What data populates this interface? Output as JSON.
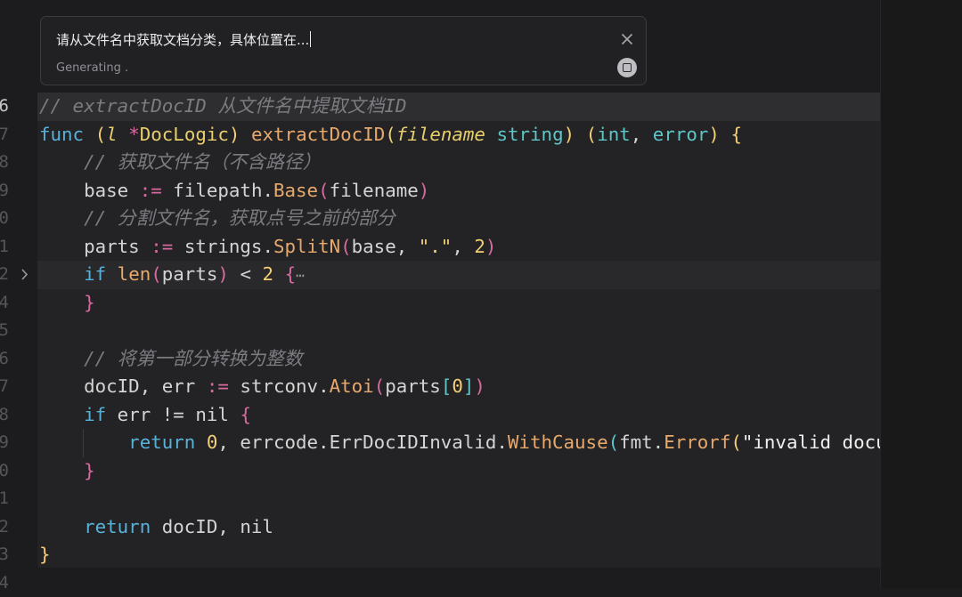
{
  "prompt": {
    "input_text": "请从文件名中获取文档分类，具体位置在...",
    "status_text": "Generating",
    "status_dots": ".",
    "close_icon": "close-icon",
    "stop_icon": "stop-icon"
  },
  "gutter": {
    "line_numbers": [
      "6",
      "7",
      "8",
      "9",
      "0",
      "1",
      "2",
      "4",
      "5",
      "6",
      "7",
      "8",
      "9",
      "0",
      "1",
      "2",
      "3",
      "4"
    ],
    "fold_icon": "chevron-right-icon"
  },
  "code": {
    "l1": {
      "comment": "// extractDocID 从文件名中提取文档ID"
    },
    "l2": {
      "kw_func": "func",
      "paren_open": "(",
      "recv": "l",
      "star": "*",
      "recv_type": "DocLogic",
      "paren_close": ")",
      "fn_name": "extractDocID",
      "p_open": "(",
      "param": "filename",
      "param_type": "string",
      "p_close": ")",
      "r_open": "(",
      "r_int": "int",
      "comma": ", ",
      "r_error": "error",
      "r_close": ")",
      "brace": "{"
    },
    "l3": {
      "comment": "// 获取文件名（不含路径）"
    },
    "l4": {
      "lhs": "base",
      "op": ":=",
      "pkg": "filepath.",
      "fn": "Base",
      "open": "(",
      "arg": "filename",
      "close": ")"
    },
    "l5": {
      "comment": "// 分割文件名，获取点号之前的部分"
    },
    "l6": {
      "lhs": "parts",
      "op": ":=",
      "pkg": "strings.",
      "fn": "SplitN",
      "open": "(",
      "arg1": "base, ",
      "str": "\".\"",
      "comma": ", ",
      "num": "2",
      "close": ")"
    },
    "l7": {
      "kw": "if",
      "fn": "len",
      "open": "(",
      "arg": "parts",
      "close": ")",
      "op": "<",
      "num": "2",
      "brace": "{",
      "ellipsis": "⋯"
    },
    "l8": {
      "brace": "}"
    },
    "l10": {
      "comment": "// 将第一部分转换为整数"
    },
    "l11": {
      "lhs": "docID, err",
      "op": ":=",
      "pkg": "strconv.",
      "fn": "Atoi",
      "open": "(",
      "arg": "parts",
      "b_open": "[",
      "num": "0",
      "b_close": "]",
      "close": ")"
    },
    "l12": {
      "kw": "if",
      "lhs": "err",
      "op": "!=",
      "rhs": "nil",
      "brace": "{"
    },
    "l13": {
      "kw": "return",
      "num": "0",
      "comma": ", ",
      "pkg": "errcode.ErrDocIDInvalid.",
      "fn": "WithCause",
      "open": "(",
      "pkg2": "fmt.",
      "fn2": "Errorf",
      "open2": "(",
      "str": "\"invalid docum"
    },
    "l14": {
      "brace": "}"
    },
    "l16": {
      "kw": "return",
      "rest": "docID, nil"
    },
    "l17": {
      "brace": "}"
    }
  }
}
